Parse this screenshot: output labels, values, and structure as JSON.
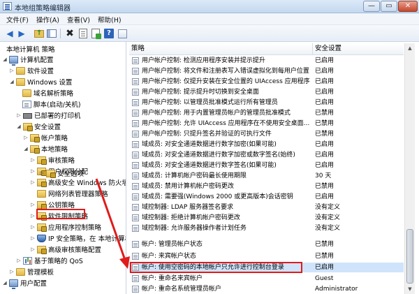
{
  "window": {
    "title": "本地组策略编辑器",
    "min": "—",
    "max": "▭",
    "close": "✕"
  },
  "menu": [
    "文件(F)",
    "操作(A)",
    "查看(V)",
    "帮助(H)"
  ],
  "toolbar": {
    "back": "◀",
    "forward": "▶",
    "delete": "✖"
  },
  "tree": [
    {
      "label": "本地计算机 策略",
      "exp": "",
      "icon": "none"
    },
    {
      "label": "计算机配置",
      "exp": "◢",
      "icon": "pc"
    },
    {
      "label": "软件设置",
      "exp": "▷",
      "icon": "folder"
    },
    {
      "label": "Windows 设置",
      "exp": "◢",
      "icon": "folder"
    },
    {
      "label": "域名解析策略",
      "exp": "",
      "icon": "folder"
    },
    {
      "label": "脚本(启动/关机)",
      "exp": "",
      "icon": "doc"
    },
    {
      "label": "已部署的打印机",
      "exp": "▷",
      "icon": "printer"
    },
    {
      "label": "安全设置",
      "exp": "◢",
      "icon": "lockfold"
    },
    {
      "label": "帐户策略",
      "exp": "▷",
      "icon": "lockfold"
    },
    {
      "label": "本地策略",
      "exp": "◢",
      "icon": "lockfold"
    },
    {
      "label": "审核策略",
      "exp": "▷",
      "icon": "lockfold"
    },
    {
      "label": "用户权限分配",
      "exp": "▷",
      "icon": "lockfold"
    },
    {
      "label": "安全选项",
      "exp": "▷",
      "icon": "lockfold"
    },
    {
      "label": "高级安全 Windows 防火墙",
      "exp": "▷",
      "icon": "lockfold"
    },
    {
      "label": "网络列表管理器策略",
      "exp": "",
      "icon": "folder"
    },
    {
      "label": "公钥策略",
      "exp": "▷",
      "icon": "lockfold"
    },
    {
      "label": "软件限制策略",
      "exp": "▷",
      "icon": "lockfold"
    },
    {
      "label": "应用程序控制策略",
      "exp": "▷",
      "icon": "lockfold"
    },
    {
      "label": "IP 安全策略，在 本地计算机",
      "exp": "▷",
      "icon": "shield"
    },
    {
      "label": "高级审核策略配置",
      "exp": "▷",
      "icon": "lockfold"
    },
    {
      "label": "基于策略的 QoS",
      "exp": "▷",
      "icon": "chart"
    },
    {
      "label": "管理模板",
      "exp": "▷",
      "icon": "folder"
    },
    {
      "label": "用户配置",
      "exp": "◢",
      "icon": "pc"
    }
  ],
  "columns": {
    "policy": "策略",
    "setting": "安全设置"
  },
  "policies": [
    {
      "name": "用户帐户控制: 检测应用程序安装并提示提升",
      "value": "已启用"
    },
    {
      "name": "用户帐户控制: 将文件和注册表写入错误虚拟化到每用户位置",
      "value": "已启用"
    },
    {
      "name": "用户帐户控制: 仅提升安装在安全位置的 UIAccess 应用程序",
      "value": "已启用"
    },
    {
      "name": "用户帐户控制: 提示提升时切换到安全桌面",
      "value": "已启用"
    },
    {
      "name": "用户帐户控制: 以管理员批准模式运行所有管理员",
      "value": "已启用"
    },
    {
      "name": "用户帐户控制: 用于内置管理员帐户的管理员批准模式",
      "value": "已禁用"
    },
    {
      "name": "用户帐户控制: 允许 UIAccess 应用程序在不使用安全桌面...",
      "value": "已禁用"
    },
    {
      "name": "用户帐户控制: 只提升签名并验证的可执行文件",
      "value": "已禁用"
    },
    {
      "name": "域成员: 对安全通道数据进行数字加密(如果可能)",
      "value": "已启用"
    },
    {
      "name": "域成员: 对安全通道数据进行数字加密或数字签名(始终)",
      "value": "已启用"
    },
    {
      "name": "域成员: 对安全通道数据进行数字签名(如果可能)",
      "value": "已启用"
    },
    {
      "name": "域成员: 计算机帐户密码最长使用期限",
      "value": "30 天"
    },
    {
      "name": "域成员: 禁用计算机帐户密码更改",
      "value": "已禁用"
    },
    {
      "name": "域成员: 需要强(Windows 2000 或更高版本)会话密钥",
      "value": "已启用"
    },
    {
      "name": "域控制器: LDAP 服务器签名要求",
      "value": "没有定义"
    },
    {
      "name": "域控制器: 拒绝计算机帐户密码更改",
      "value": "没有定义"
    },
    {
      "name": "域控制器: 允许服务器操作者计划任务",
      "value": "没有定义"
    },
    {
      "name": "帐户: 管理员帐户状态",
      "value": "已禁用"
    },
    {
      "name": "帐户: 来宾帐户状态",
      "value": "已禁用"
    },
    {
      "name": "帐户: 使用空密码的本地帐户只允许进行控制台登录",
      "value": "已启用"
    },
    {
      "name": "帐户: 重命名来宾帐户",
      "value": "Guest"
    },
    {
      "name": "帐户: 重命名系统管理员帐户",
      "value": "Administrator"
    }
  ],
  "scroll": {
    "up": "▲",
    "down": "▼"
  }
}
